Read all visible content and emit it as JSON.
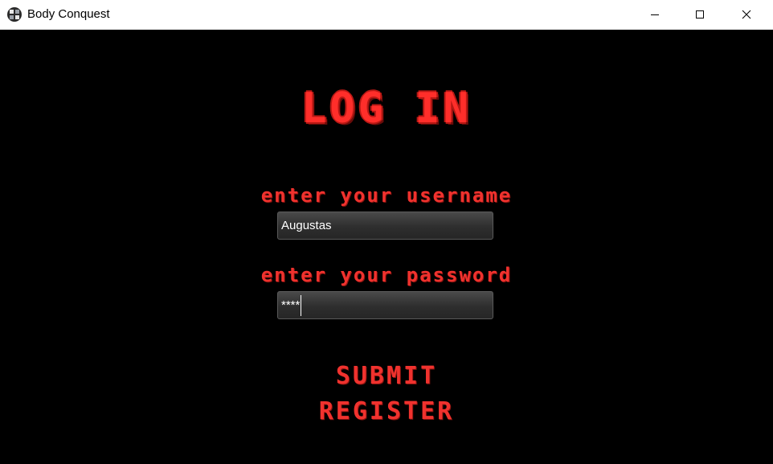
{
  "window": {
    "title": "Body Conquest",
    "icon": "app-logo-icon",
    "controls": [
      "minimize-icon",
      "maximize-icon",
      "close-icon"
    ]
  },
  "login": {
    "heading": "LOG IN",
    "username_label": "enter your username",
    "username_value": "Augustas",
    "password_label": "enter your password",
    "password_value": "****",
    "submit_label": "SUBMIT",
    "register_label": "REGISTER"
  },
  "colors": {
    "accent": "#f0322e",
    "background": "#000000",
    "field_background": "#333333",
    "titlebar": "#ffffff"
  }
}
